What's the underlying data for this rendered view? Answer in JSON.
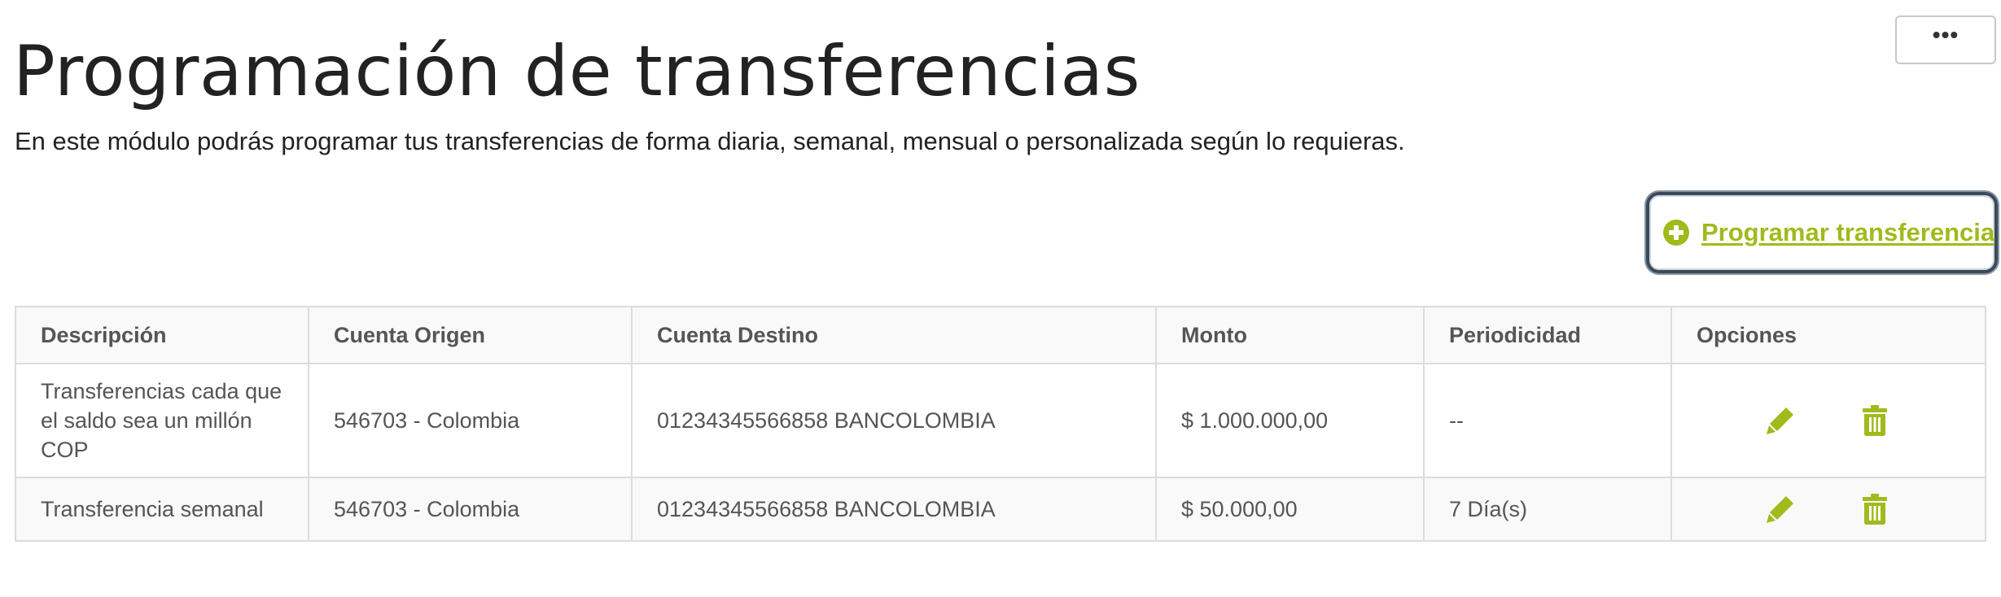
{
  "header": {
    "title": "Programación de transferencias",
    "subtitle": "En este módulo podrás programar tus transferencias de forma diaria, semanal, mensual o personalizada según lo requieras.",
    "more_label": "•••"
  },
  "actions": {
    "add_label": "Programar transferencia",
    "add_icon": "plus-circle-icon"
  },
  "table": {
    "columns": [
      "Descripción",
      "Cuenta Origen",
      "Cuenta Destino",
      "Monto",
      "Periodicidad",
      "Opciones"
    ],
    "rows": [
      {
        "description": "Transferencias cada que el saldo sea un millón COP",
        "origin": "546703 - Colombia",
        "destination": "01234345566858 BANCOLOMBIA",
        "amount": "$ 1.000.000,00",
        "periodicity": "--"
      },
      {
        "description": "Transferencia semanal",
        "origin": "546703 - Colombia",
        "destination": "01234345566858 BANCOLOMBIA",
        "amount": "$ 50.000,00",
        "periodicity": "7 Día(s)"
      }
    ],
    "row_icons": [
      "pencil-icon",
      "trash-icon"
    ]
  },
  "colors": {
    "accent": "#9fbb1c",
    "text": "#222222",
    "table_text": "#555555",
    "border": "#dcdcdc",
    "focus_ring": "#3a4a58"
  }
}
